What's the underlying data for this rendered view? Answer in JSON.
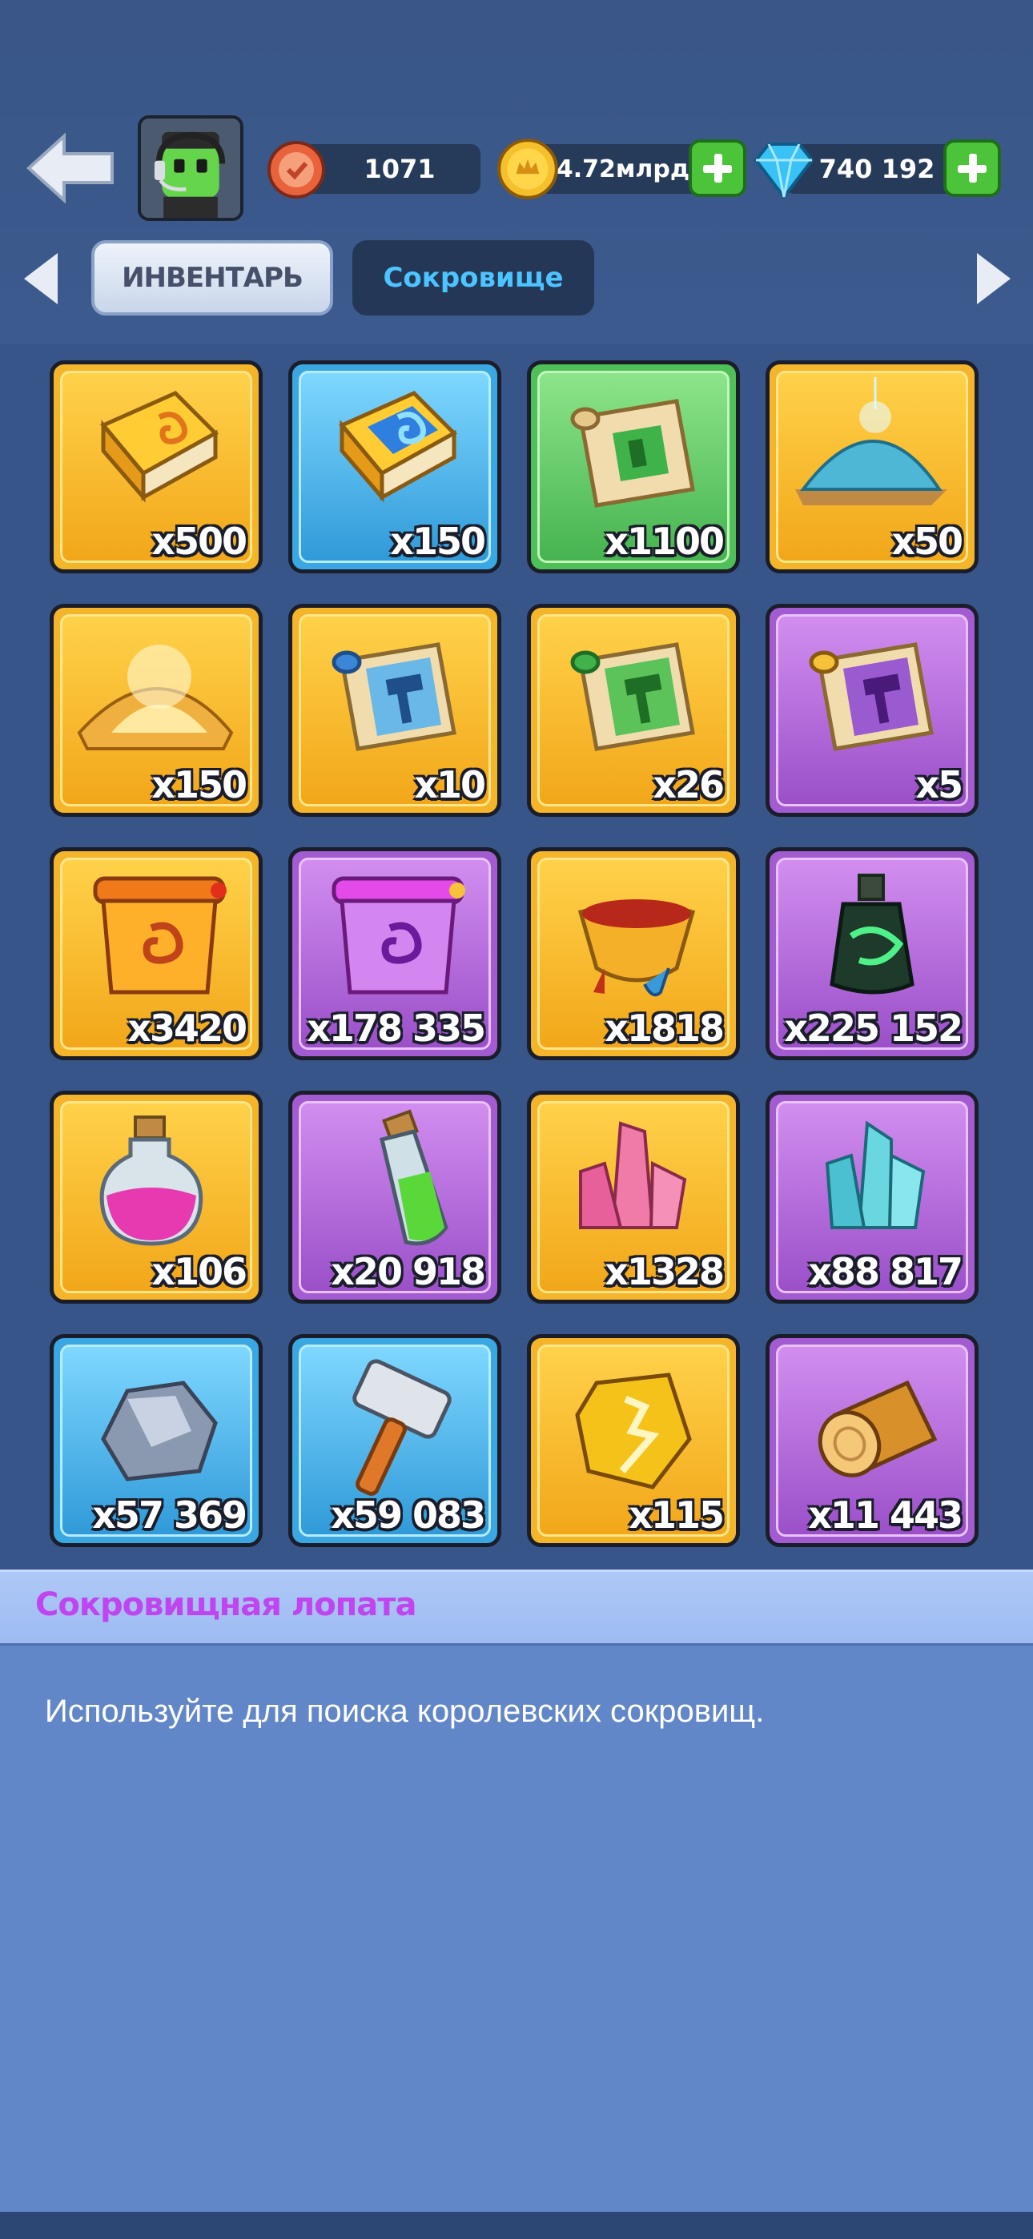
{
  "header": {
    "trophies": "1071",
    "gold": "4.72млрд",
    "gems": "740 192"
  },
  "tabs": {
    "inventory": "ИНВЕНТАРЬ",
    "treasure": "Сокровище"
  },
  "items": [
    {
      "qty": "x500",
      "icon": "golden-spellbook-icon",
      "rarity": "gold"
    },
    {
      "qty": "x150",
      "icon": "blue-spellbook-icon",
      "rarity": "blue"
    },
    {
      "qty": "x1100",
      "icon": "green-scroll-icon",
      "rarity": "green"
    },
    {
      "qty": "x50",
      "icon": "blue-sand-pile-icon",
      "rarity": "gold"
    },
    {
      "qty": "x150",
      "icon": "golden-dust-pile-icon",
      "rarity": "gold"
    },
    {
      "qty": "x10",
      "icon": "blue-hammer-scroll-icon",
      "rarity": "gold"
    },
    {
      "qty": "x26",
      "icon": "green-hammer-scroll-icon",
      "rarity": "gold"
    },
    {
      "qty": "x5",
      "icon": "purple-hammer-scroll-icon",
      "rarity": "purple"
    },
    {
      "qty": "x3420",
      "icon": "orange-spiral-scroll-icon",
      "rarity": "gold"
    },
    {
      "qty": "x178 335",
      "icon": "purple-spiral-scroll-icon",
      "rarity": "purple"
    },
    {
      "qty": "x1818",
      "icon": "red-potion-bowl-icon",
      "rarity": "gold"
    },
    {
      "qty": "x225 152",
      "icon": "green-poison-bottle-icon",
      "rarity": "purple"
    },
    {
      "qty": "x106",
      "icon": "pink-potion-flask-icon",
      "rarity": "gold"
    },
    {
      "qty": "x20 918",
      "icon": "green-potion-vial-icon",
      "rarity": "purple"
    },
    {
      "qty": "x1328",
      "icon": "pink-crystal-icon",
      "rarity": "gold"
    },
    {
      "qty": "x88 817",
      "icon": "cyan-crystal-icon",
      "rarity": "purple"
    },
    {
      "qty": "x57 369",
      "icon": "stone-ore-icon",
      "rarity": "blue"
    },
    {
      "qty": "x59 083",
      "icon": "hammer-icon",
      "rarity": "blue"
    },
    {
      "qty": "x115",
      "icon": "golden-rune-stone-icon",
      "rarity": "gold"
    },
    {
      "qty": "x11 443",
      "icon": "wood-log-icon",
      "rarity": "purple"
    }
  ],
  "detail": {
    "title": "Сокровищная лопата",
    "description": "Используйте для поиска королевских сокровищ."
  },
  "colors": {
    "background": "#38558a",
    "title_accent": "#c044f0",
    "tab_active_text": "#4cc4ff"
  }
}
